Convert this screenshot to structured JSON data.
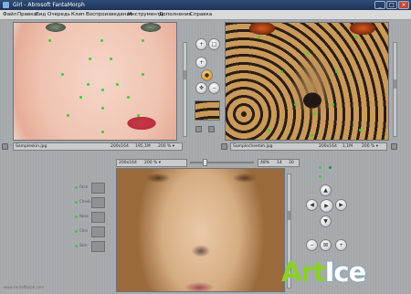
{
  "window": {
    "title": "Girl - Abrosoft FantaMorph"
  },
  "menu": [
    "Файл",
    "Правка",
    "Вид",
    "Очередь",
    "Клип",
    "Воспроизведение",
    "Инструменты",
    "Дополнения",
    "Справка"
  ],
  "left_panel": {
    "filename": "Sampleskin.jpg",
    "dims": "200x164",
    "size": "195,1M",
    "zoom": "200 % ▾"
  },
  "right_panel": {
    "filename": "Samplecheetah.jpg",
    "dims": "200x164",
    "size": "1,1M",
    "zoom": "200 % ▾"
  },
  "preview_bar": {
    "dims": "200x164",
    "zoom": "200 % ▾",
    "percent": "48%",
    "frame": "14",
    "total": "30"
  },
  "morph_items": [
    "Face",
    "Cheek",
    "Nose",
    "Chin",
    "Skin"
  ],
  "icons": {
    "play": "play-icon",
    "prev": "arrow-left-icon",
    "next": "arrow-right-icon",
    "up": "arrow-up-icon",
    "down": "arrow-down-icon",
    "zoom": "zoom-icon"
  },
  "logo": {
    "part1": "Art",
    "part2": "Ice"
  },
  "watermark": "www.FantaMorph.com",
  "colors": {
    "accent_green": "#35d135",
    "logo_green": "#8bd02a",
    "titlebar": "#1d3357"
  }
}
